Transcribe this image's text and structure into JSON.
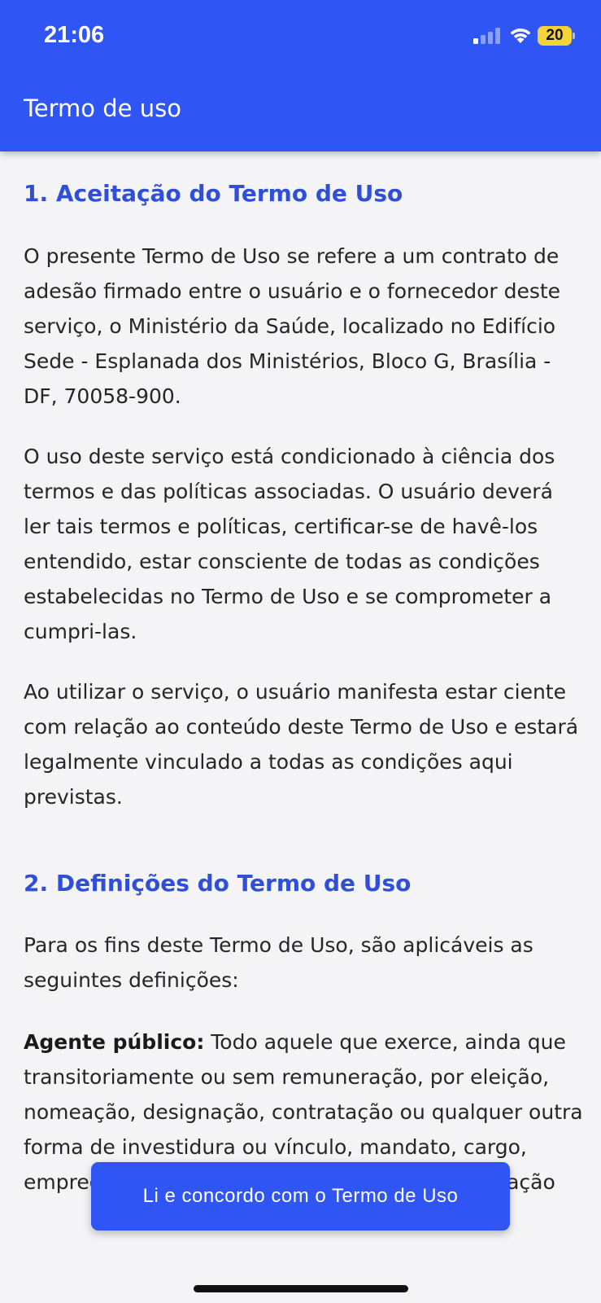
{
  "status_bar": {
    "time": "21:06",
    "battery": "20"
  },
  "header": {
    "title": "Termo de uso"
  },
  "sections": [
    {
      "heading": "1. Aceitação do Termo de Uso",
      "paragraphs": [
        "O presente Termo de Uso se refere a um contrato de adesão firmado entre o usuário e o fornecedor deste serviço, o Ministério da Saúde, localizado no Edifício Sede - Esplanada dos Ministérios, Bloco G, Brasília - DF, 70058-900.",
        "O uso deste serviço está condicionado à ciência dos termos e das políticas associadas. O usuário deverá ler tais termos e políticas, certificar-se de havê-los entendido, estar consciente de todas as condições estabelecidas no Termo de Uso e se comprometer a cumpri-las.",
        "Ao utilizar o serviço, o usuário manifesta estar ciente com relação ao conteúdo deste Termo de Uso e estará legalmente vinculado a todas as condições aqui previstas."
      ]
    },
    {
      "heading": "2. Definições do Termo de Uso",
      "paragraphs": [
        "Para os fins deste Termo de Uso, são aplicáveis as seguintes definições:"
      ],
      "definition": {
        "term": "Agente público:",
        "text": " Todo aquele que exerce, ainda que transitoriamente ou sem remuneração, por eleição, nomeação, designação, contratação ou qualquer outra forma de investidura ou vínculo, mandato, cargo, emprego ou função nas entidades da Administração"
      }
    }
  ],
  "agree_button": {
    "label": "Li e concordo com o Termo de Uso"
  },
  "colors": {
    "primary": "#3055f5",
    "heading": "#2f4fd8",
    "background": "#f4f4f6"
  }
}
